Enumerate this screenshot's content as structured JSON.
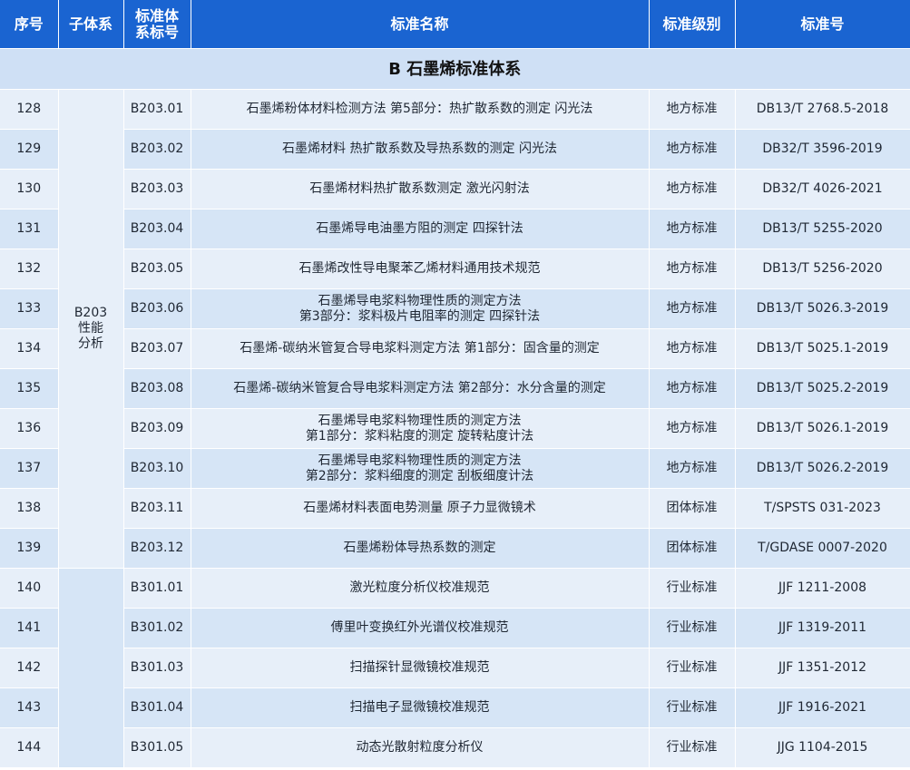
{
  "header": {
    "seq": "序号",
    "subsystem": "子体系",
    "code_l1": "标准体",
    "code_l2": "系标号",
    "name": "标准名称",
    "level": "标准级别",
    "number": "标准号"
  },
  "section_title": "B 石墨烯标准体系",
  "group1": {
    "l1": "B203",
    "l2": "性能",
    "l3": "分析"
  },
  "group2": {
    "label": ""
  },
  "rows": [
    {
      "seq": "128",
      "code": "B203.01",
      "name1": "石墨烯粉体材料检测方法 第5部分：热扩散系数的测定 闪光法",
      "name2": "",
      "level": "地方标准",
      "number": "DB13/T 2768.5-2018"
    },
    {
      "seq": "129",
      "code": "B203.02",
      "name1": "石墨烯材料 热扩散系数及导热系数的测定 闪光法",
      "name2": "",
      "level": "地方标准",
      "number": "DB32/T 3596-2019"
    },
    {
      "seq": "130",
      "code": "B203.03",
      "name1": "石墨烯材料热扩散系数测定 激光闪射法",
      "name2": "",
      "level": "地方标准",
      "number": "DB32/T 4026-2021"
    },
    {
      "seq": "131",
      "code": "B203.04",
      "name1": "石墨烯导电油墨方阻的测定 四探针法",
      "name2": "",
      "level": "地方标准",
      "number": "DB13/T 5255-2020"
    },
    {
      "seq": "132",
      "code": "B203.05",
      "name1": "石墨烯改性导电聚苯乙烯材料通用技术规范",
      "name2": "",
      "level": "地方标准",
      "number": "DB13/T 5256-2020"
    },
    {
      "seq": "133",
      "code": "B203.06",
      "name1": "石墨烯导电浆料物理性质的测定方法",
      "name2": "第3部分：浆料极片电阻率的测定 四探针法",
      "level": "地方标准",
      "number": "DB13/T 5026.3-2019"
    },
    {
      "seq": "134",
      "code": "B203.07",
      "name1": "石墨烯-碳纳米管复合导电浆料测定方法 第1部分：固含量的测定",
      "name2": "",
      "level": "地方标准",
      "number": "DB13/T 5025.1-2019"
    },
    {
      "seq": "135",
      "code": "B203.08",
      "name1": "石墨烯-碳纳米管复合导电浆料测定方法 第2部分：水分含量的测定",
      "name2": "",
      "level": "地方标准",
      "number": "DB13/T 5025.2-2019"
    },
    {
      "seq": "136",
      "code": "B203.09",
      "name1": "石墨烯导电浆料物理性质的测定方法",
      "name2": "第1部分：浆料粘度的测定 旋转粘度计法",
      "level": "地方标准",
      "number": "DB13/T 5026.1-2019"
    },
    {
      "seq": "137",
      "code": "B203.10",
      "name1": "石墨烯导电浆料物理性质的测定方法",
      "name2": "第2部分：浆料细度的测定 刮板细度计法",
      "level": "地方标准",
      "number": "DB13/T 5026.2-2019"
    },
    {
      "seq": "138",
      "code": "B203.11",
      "name1": "石墨烯材料表面电势测量 原子力显微镜术",
      "name2": "",
      "level": "团体标准",
      "number": "T/SPSTS 031-2023"
    },
    {
      "seq": "139",
      "code": "B203.12",
      "name1": "石墨烯粉体导热系数的测定",
      "name2": "",
      "level": "团体标准",
      "number": "T/GDASE 0007-2020"
    },
    {
      "seq": "140",
      "code": "B301.01",
      "name1": "激光粒度分析仪校准规范",
      "name2": "",
      "level": "行业标准",
      "number": "JJF 1211-2008"
    },
    {
      "seq": "141",
      "code": "B301.02",
      "name1": "傅里叶变换红外光谱仪校准规范",
      "name2": "",
      "level": "行业标准",
      "number": "JJF 1319-2011"
    },
    {
      "seq": "142",
      "code": "B301.03",
      "name1": "扫描探针显微镜校准规范",
      "name2": "",
      "level": "行业标准",
      "number": "JJF 1351-2012"
    },
    {
      "seq": "143",
      "code": "B301.04",
      "name1": "扫描电子显微镜校准规范",
      "name2": "",
      "level": "行业标准",
      "number": "JJF 1916-2021"
    },
    {
      "seq": "144",
      "code": "B301.05",
      "name1": "动态光散射粒度分析仪",
      "name2": "",
      "level": "行业标准",
      "number": "JJG 1104-2015"
    }
  ]
}
